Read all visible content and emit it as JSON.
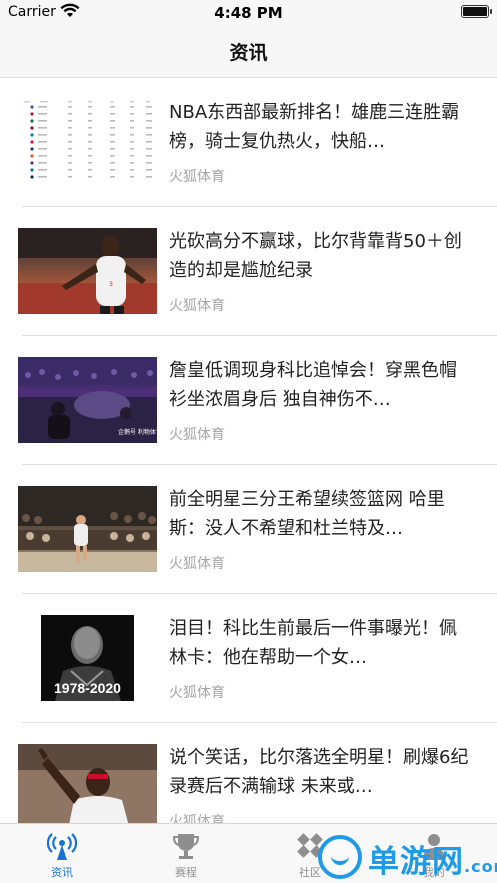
{
  "status_bar": {
    "carrier": "Carrier",
    "time": "4:48 PM",
    "battery_level": 1.0
  },
  "nav": {
    "title": "资讯"
  },
  "news": [
    {
      "title": "NBA东西部最新排名！雄鹿三连胜霸榜，骑士复仇热火，快船…",
      "source": "火狐体育",
      "thumb_icon": "standings-table-image"
    },
    {
      "title": "光砍高分不赢球，比尔背靠背50＋创造的却是尴尬纪录",
      "source": "火狐体育",
      "thumb_icon": "basketball-player-photo"
    },
    {
      "title": "詹皇低调现身科比追悼会！穿黑色帽衫坐浓眉身后 独自神伤不…",
      "source": "火狐体育",
      "thumb_icon": "arena-memorial-photo",
      "thumb_caption": "企鹅号 利物体育"
    },
    {
      "title": "前全明星三分王希望续签篮网 哈里斯：没人不希望和杜兰特及…",
      "source": "火狐体育",
      "thumb_icon": "basketball-game-photo"
    },
    {
      "title": "泪目！科比生前最后一件事曝光！佩林卡：他在帮助一个女…",
      "source": "火狐体育",
      "thumb_icon": "kobe-memorial-photo",
      "thumb_caption": "1978-2020"
    },
    {
      "title": "说个笑话，比尔落选全明星！刷爆6纪录赛后不满输球 未来或…",
      "source": "火狐体育",
      "thumb_icon": "basketball-player-photo"
    }
  ],
  "tabs": [
    {
      "label": "资讯",
      "icon": "broadcast-icon",
      "active": true
    },
    {
      "label": "赛程",
      "icon": "trophy-icon",
      "active": false
    },
    {
      "label": "社区",
      "icon": "community-icon",
      "active": false
    },
    {
      "label": "我的",
      "icon": "person-icon",
      "active": false
    }
  ],
  "watermark": {
    "text": "单游网",
    "suffix": ".com"
  },
  "colors": {
    "accent": "#1b72d6",
    "source_text": "#a5a5a5",
    "watermark": "#1e9ae8"
  }
}
